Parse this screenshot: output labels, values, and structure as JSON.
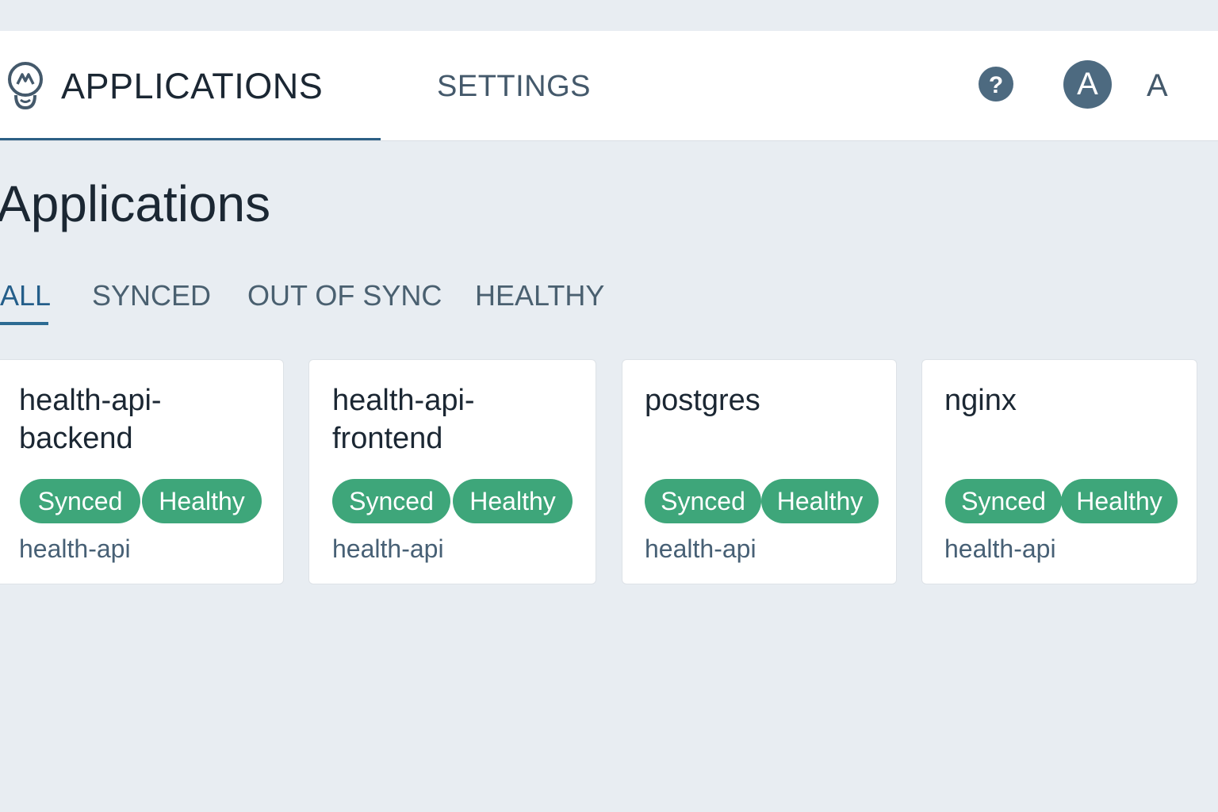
{
  "header": {
    "nav_applications": "APPLICATIONS",
    "nav_settings": "SETTINGS",
    "help_icon": "help-circle-icon",
    "avatar_initial": "A",
    "user_label": "A"
  },
  "page": {
    "title": "Applications"
  },
  "filters": {
    "tabs": [
      "ALL",
      "SYNCED",
      "OUT OF SYNC",
      "HEALTHY"
    ],
    "active": "ALL"
  },
  "applications": [
    {
      "name": "health-api-\nbackend",
      "sync_status": "Synced",
      "health_status": "Healthy",
      "namespace": "health-api"
    },
    {
      "name": "health-api-\nfrontend",
      "sync_status": "Synced",
      "health_status": "Healthy",
      "namespace": "health-api"
    },
    {
      "name": "postgres",
      "sync_status": "Synced",
      "health_status": "Healthy",
      "namespace": "health-api"
    },
    {
      "name": "nginx",
      "sync_status": "Synced",
      "health_status": "Healthy",
      "namespace": "health-api"
    }
  ],
  "colors": {
    "accent": "#2c5f85",
    "status_green": "#3ea67a",
    "background": "#e8edf2"
  }
}
